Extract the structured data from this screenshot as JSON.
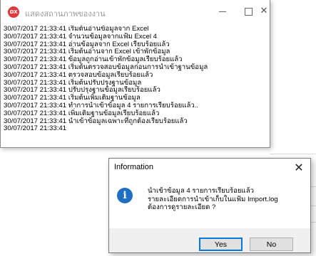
{
  "main_window": {
    "title": "แสดงสถานภาพของงาน",
    "icon_label": "DX",
    "controls": {
      "minimize": "—",
      "maximize": "☐",
      "close": "✕"
    }
  },
  "log_lines": [
    "30/07/2017 21:33:41 เริ่มต้นอ่านข้อมูลจาก Excel",
    "30/07/2017 21:33:41 จำนวนข้อมูลจากแฟ้ม Excel 4",
    "30/07/2017 21:33:41 อ่านข้อมูลจาก Excel เรียบร้อยแล้ว",
    "30/07/2017 21:33:41 เริ่มต้นอ่านจาก Excel เข้าพักข้อมูล",
    "30/07/2017 21:33:41 ข้อมูลถูกอ่านเข้าพักข้อมูลเรียบร้อยแล้ว",
    "30/07/2017 21:33:41 เริ่มต้นตรวจสอบข้อมูลก่อนการนำเข้าฐานข้อมูล",
    "30/07/2017 21:33:41 ตรวจสอบข้อมูลเรียบร้อยแล้ว",
    "30/07/2017 21:33:41 เริ่มต้นปรับปรุงฐานข้อมูล",
    "30/07/2017 21:33:41 ปรับปรุงฐานข้อมูลเรียบร้อยแล้ว",
    "30/07/2017 21:33:41 เริ่มต้นเพิ่มเติมฐานข้อมูล",
    "30/07/2017 21:33:41 ทำการนำเข้าข้อมูล 4 รายการเรียบร้อยแล้ว..",
    "30/07/2017 21:33:41 เพิ่มเติมฐานข้อมูลเรียบร้อยแล้ว",
    "30/07/2017 21:33:41 นำเข้าข้อมูลเฉพาะที่ถูกต้องเรียบร้อยแล้ว",
    "30/07/2017 21:33:41"
  ],
  "dialog": {
    "title": "Information",
    "close": "✕",
    "icon_glyph": "i",
    "message_lines": [
      "นำเข้าข้อมูล 4 รายการเรียบร้อยแล้ว",
      "รายละเอียดการนำเข้าเก็บในแฟ้ม Import.log",
      "ต้องการดูรายละเอียด ?"
    ],
    "yes_label": "Yes",
    "no_label": "No"
  },
  "colors": {
    "accent": "#0078d7",
    "info_icon": "#1e6fc2",
    "app_icon": "#e2393c"
  }
}
